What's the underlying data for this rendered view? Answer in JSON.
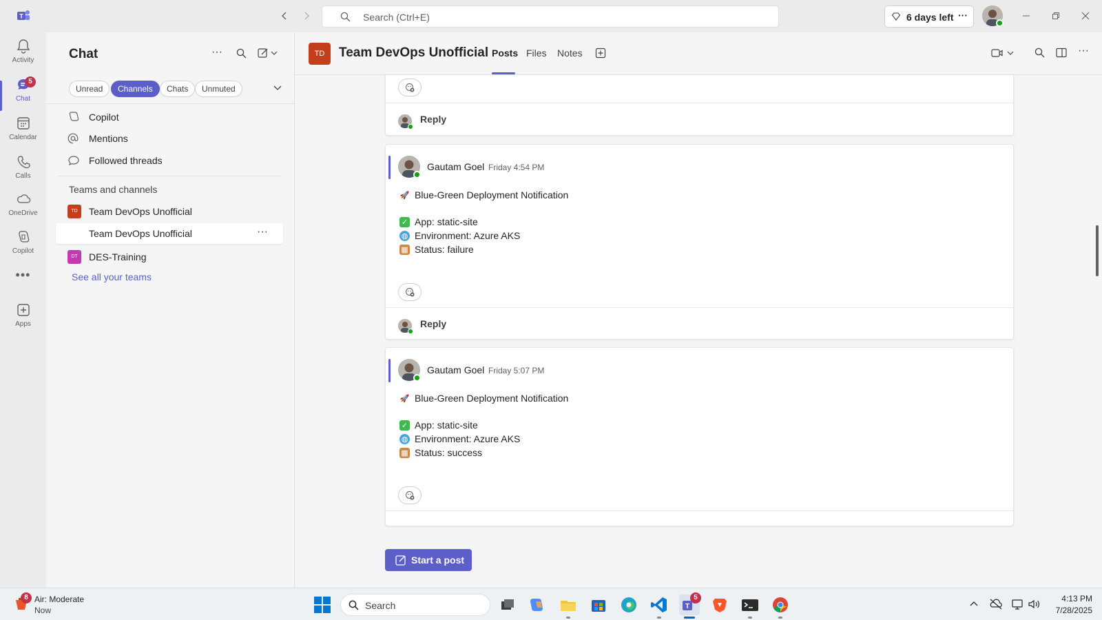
{
  "titlebar": {
    "search_placeholder": "Search (Ctrl+E)",
    "trial_label": "6 days left"
  },
  "rail": {
    "items": [
      {
        "label": "Activity"
      },
      {
        "label": "Chat",
        "badge": "5"
      },
      {
        "label": "Calendar"
      },
      {
        "label": "Calls"
      },
      {
        "label": "OneDrive"
      },
      {
        "label": "Copilot"
      },
      {
        "label": "Apps"
      }
    ]
  },
  "chatlist": {
    "title": "Chat",
    "filters": [
      "Unread",
      "Channels",
      "Chats",
      "Unmuted"
    ],
    "nav": [
      "Copilot",
      "Mentions",
      "Followed threads"
    ],
    "section": "Teams and channels",
    "teams": [
      {
        "name": "Team DevOps Unofficial",
        "abbr": "TD"
      },
      {
        "channel": "Team DevOps Unofficial"
      },
      {
        "name": "DES-Training",
        "abbr": "DT"
      }
    ],
    "see_all": "See all your teams"
  },
  "header": {
    "avatar": "TD",
    "title": "Team DevOps Unofficial",
    "tabs": [
      "Posts",
      "Files",
      "Notes"
    ]
  },
  "posts": [
    {
      "author": "Gautam Goel",
      "time": "Friday 4:54 PM",
      "title": "Blue-Green Deployment Notification",
      "app": "App: static-site",
      "env": "Environment: Azure AKS",
      "status": "Status: failure",
      "reply": "Reply"
    },
    {
      "author": "Gautam Goel",
      "time": "Friday 5:07 PM",
      "title": "Blue-Green Deployment Notification",
      "app": "App: static-site",
      "env": "Environment: Azure AKS",
      "status": "Status: success"
    }
  ],
  "first_reply": "Reply",
  "start_post": "Start a post",
  "taskbar": {
    "weather_badge": "8",
    "weather_title": "Air: Moderate",
    "weather_sub": "Now",
    "search": "Search",
    "teams_badge": "5",
    "time": "4:13 PM",
    "date": "7/28/2025"
  },
  "colors": {
    "accent": "#5b5fc7",
    "presence": "#13a10e",
    "team_td": "#c43e1c",
    "team_dt": "#c239b3"
  }
}
